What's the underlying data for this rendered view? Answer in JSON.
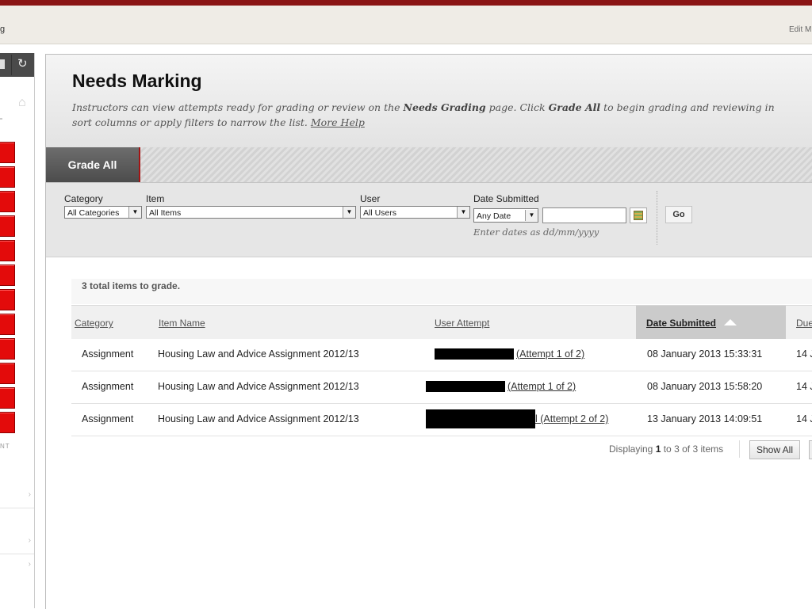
{
  "breadcrumb": {
    "fragment": "g"
  },
  "header_right": {
    "edit_mode": "Edit M"
  },
  "sidebar": {
    "tools": [
      "collapse-icon",
      "refresh-icon"
    ],
    "home_icon": "home-icon",
    "menu_button_count": 12,
    "section_label": "NT",
    "chevron": "›"
  },
  "page": {
    "title": "Needs Marking",
    "description": {
      "part1": "Instructors can view attempts ready for grading or review on the ",
      "bold1": "Needs Grading",
      "part2": " page. Click ",
      "bold2": "Grade All",
      "part3": " to begin grading and reviewing in",
      "part4": "sort columns or apply filters to narrow the list. ",
      "more_help": "More Help"
    },
    "action_bar": {
      "grade_all": "Grade All"
    }
  },
  "filters": {
    "category": {
      "label": "Category",
      "value": "All Categories"
    },
    "item": {
      "label": "Item",
      "value": "All Items"
    },
    "user": {
      "label": "User",
      "value": "All Users"
    },
    "date": {
      "label": "Date Submitted",
      "value": "Any Date",
      "input_value": "",
      "hint": "Enter dates as dd/mm/yyyy"
    },
    "go": "Go"
  },
  "summary": {
    "total": "3 total items to grade."
  },
  "table": {
    "headers": {
      "category": "Category",
      "item_name": "Item Name",
      "user_attempt": "User Attempt",
      "date_submitted": "Date Submitted",
      "due": "Due"
    },
    "sorted_by": "date_submitted",
    "rows": [
      {
        "category": "Assignment",
        "item": "Housing Law and Advice Assignment 2012/13",
        "attempt": "(Attempt 1 of 2)",
        "date": "08 January 2013 15:33:31",
        "due": "14 J"
      },
      {
        "category": "Assignment",
        "item": "Housing Law and Advice Assignment 2012/13",
        "attempt": "(Attempt 1 of 2)",
        "date": "08 January 2013 15:58:20",
        "due": "14 J"
      },
      {
        "category": "Assignment",
        "item": "Housing Law and Advice Assignment 2012/13",
        "attempt": "l (Attempt 2 of 2)",
        "date": "13 January 2013 14:09:51",
        "due": "14 J"
      }
    ]
  },
  "paging": {
    "prefix": "Displaying ",
    "from": "1",
    "mid1": " to ",
    "to": "3",
    "mid2": " of ",
    "total": "3",
    "suffix": " items",
    "show_all": "Show All"
  },
  "colors": {
    "brand_bar": "#8a1414",
    "menu_red": "#e30b0b",
    "grade_all_bg": "#5a5a5a"
  }
}
